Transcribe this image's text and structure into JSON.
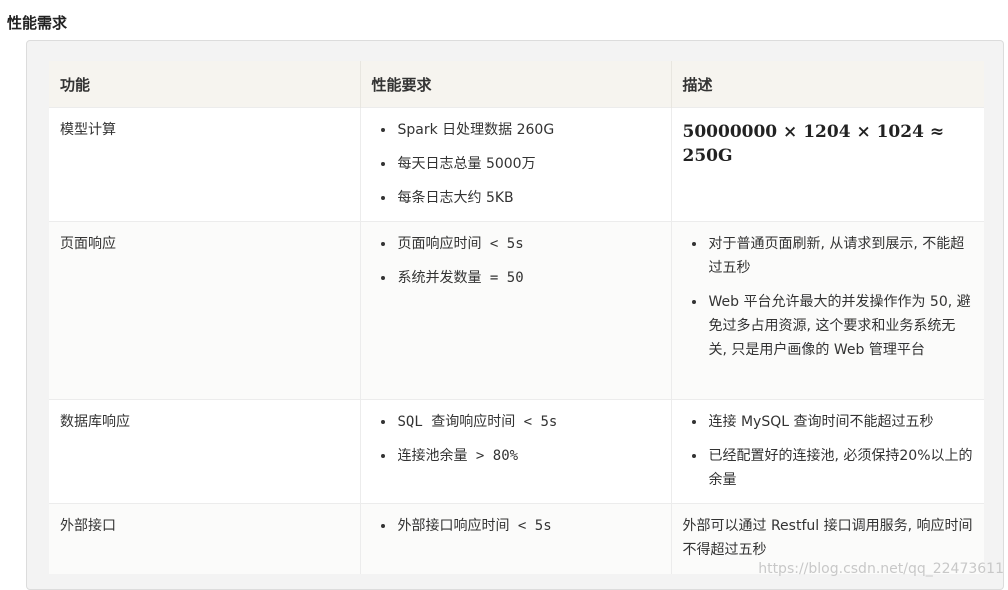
{
  "title": "性能需求",
  "table": {
    "headers": [
      "功能",
      "性能要求",
      "描述"
    ],
    "rows": [
      {
        "feature": "模型计算",
        "requirements": [
          "Spark 日处理数据 260G",
          "每天日志总量 5000万",
          "每条日志大约 5KB"
        ],
        "description_math": "50000000 × 1204 × 1024 ≈ 250G"
      },
      {
        "feature": "页面响应",
        "requirements": [
          "页面响应时间 < 5s",
          "系统并发数量 = 50"
        ],
        "description_items": [
          "对于普通页面刷新, 从请求到展示, 不能超过五秒",
          "Web 平台允许最大的并发操作作为 50, 避免过多占用资源, 这个要求和业务系统无关, 只是用户画像的 Web 管理平台"
        ]
      },
      {
        "feature": "数据库响应",
        "requirements": [
          "SQL 查询响应时间 < 5s",
          "连接池余量 > 80%"
        ],
        "description_items": [
          "连接 MySQL 查询时间不能超过五秒",
          "已经配置好的连接池, 必须保持20%以上的余量"
        ]
      },
      {
        "feature": "外部接口",
        "requirements": [
          "外部接口响应时间 < 5s"
        ],
        "description_text": "外部可以通过 Restful 接口调用服务, 响应时间不得超过五秒"
      }
    ]
  },
  "watermark": "https://blog.csdn.net/qq_22473611"
}
